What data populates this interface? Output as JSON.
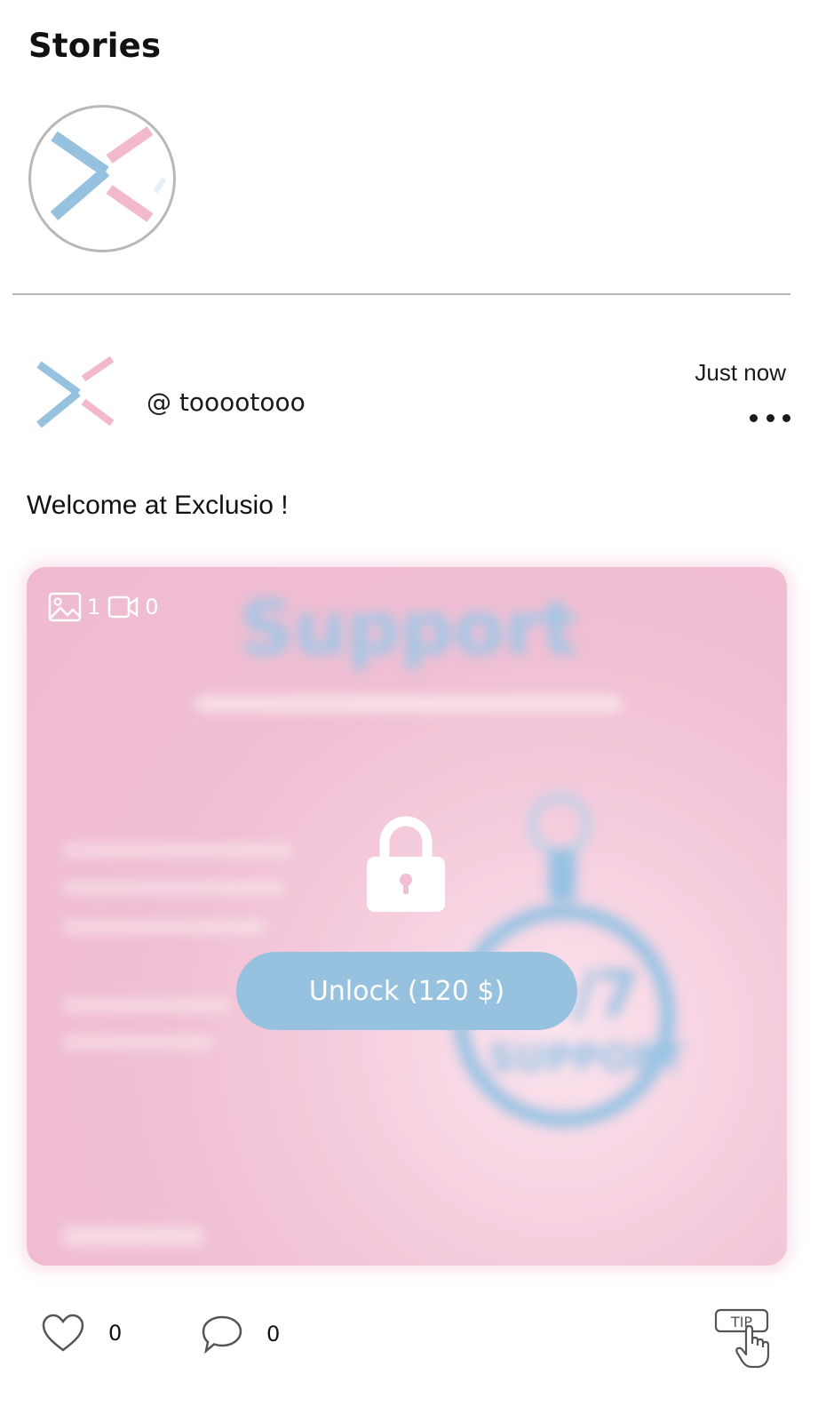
{
  "stories": {
    "title": "Stories",
    "items": [
      {
        "icon": "brand-logo-icon"
      }
    ]
  },
  "post": {
    "author": {
      "username": "@ tooootooo",
      "avatar_icon": "brand-logo-icon"
    },
    "timestamp": "Just now",
    "more_icon": "more-dots-icon",
    "caption": "Welcome at Exclusio !",
    "media": {
      "image_count": "1",
      "video_count": "0",
      "image_icon": "image-icon",
      "video_icon": "video-icon",
      "lock_icon": "lock-icon",
      "unlock_label": "Unlock (120 $)"
    },
    "actions": {
      "likes": "0",
      "comments": "0",
      "like_icon": "heart-icon",
      "comment_icon": "comment-bubble-icon",
      "tip_label": "TIP",
      "tip_icon": "tip-hand-icon"
    }
  },
  "colors": {
    "brand_blue": "#96c2e0",
    "brand_pink": "#f2b8cc",
    "media_background": "#efbad0"
  }
}
